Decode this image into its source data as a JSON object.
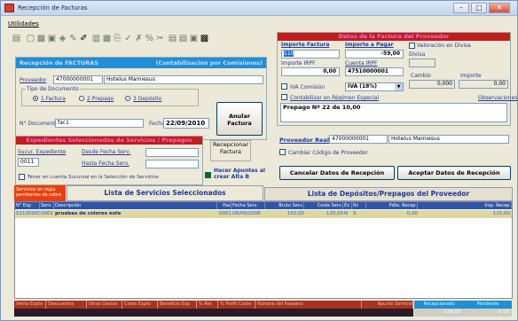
{
  "window": {
    "title": "Recepción de Facturas",
    "min": "–",
    "max": "□",
    "close": "✕"
  },
  "menu": {
    "utilidades": "Utilidades"
  },
  "left_header": {
    "title": "Recepción de FACTURAS",
    "mode": "(Contabilización por Comisiones)"
  },
  "proveedor": {
    "label": "Proveedor",
    "code": "47000000001",
    "name": "Hotelus Mamiesus"
  },
  "tipo_documento": {
    "legend": "Tipo de Documento",
    "options": [
      "1 Factura",
      "2 Prepago",
      "3 Depósito"
    ],
    "selected": "1 Factura"
  },
  "documento": {
    "label": "N° Documento",
    "value": "fac1",
    "fecha_label": "Fecha",
    "fecha": "22/09/2010"
  },
  "anular_button": "Anular Factura",
  "servicios_box": {
    "header": "Expedientes Seleccionados de Servicios / Prepagos",
    "sucursal_label": "Sucur. Expediente",
    "sucursal": "0011",
    "desde_label": "Desde Fecha Serv.",
    "hasta_label": "Hasta Fecha Serv.",
    "tener_cuenta": "Tener en cuenta Sucursal en la Selección de Servicios",
    "tener_checked": true
  },
  "recepcionar_button": "Recepcionar Factura",
  "hacer_apuntes": {
    "label": "Hacer Apuntes al crear Alta B",
    "checked": true
  },
  "datos": {
    "header": "Datos de la Factura del Proveedor",
    "importe_factura_label": "Importe Factura",
    "importe_factura": "110",
    "importe_pagar_label": "Importe a Pagar",
    "importe_pagar": "-59,00",
    "importe_irpf_label": "Importe IRPF",
    "importe_irpf": "0,00",
    "cuenta_irpf_label": "Cuenta IRPF",
    "cuenta_irpf": "47510000001",
    "valoracion_label": "Valoración en Divisa",
    "divisa_label": "Divisa",
    "cambio_label": "Cambio",
    "cambio": "0,000",
    "importe_label": "Importe",
    "importe": "0,00",
    "iva_comision_label": "IVA Comisión",
    "iva_comision": "IVA (18%)",
    "contabilizar_label": "Contabilizar en Régimen Especial",
    "observaciones_label": "Observaciones",
    "observaciones": "Prepago Nº 22 de 10,00"
  },
  "proveedor_real": {
    "label": "Proveedor Real",
    "code": "47000000001",
    "name": "Hotelus Mamiesus"
  },
  "cambiar_codigo": "Cambiar Código de Proveedor",
  "cancelar_button": "Cancelar Datos de Recepción",
  "aceptar_button": "Aceptar Datos de Recepción",
  "tabs": {
    "badge": "Servicios en regla pendientes de cobro",
    "servicios": "Lista de Servicios Seleccionados",
    "depositos": "Lista de Depósitos/Prepagos del Proveedor"
  },
  "table": {
    "headers": [
      "N° Exp",
      "Serv.",
      "Descripción",
      "Pax",
      "Fecha Serv.",
      "Bruto Serv.",
      "Coste Serv.",
      "Ex",
      "Rc",
      "Pdte. Recep.",
      "Imp. Recep."
    ],
    "rows": [
      [
        "011000000",
        "0001",
        "pruebas de colores este",
        "0001",
        "08/09/2008",
        "150,00",
        "120,00",
        "N",
        "S",
        "0,00",
        "110,00"
      ]
    ]
  },
  "footer": {
    "cols": [
      "Venta Expte",
      "Descuentos",
      "Otros Gastos",
      "Coste Expte",
      "Beneficio Exp",
      "% Ret",
      "% Profit Coste",
      "Nombre del Pasajero",
      "Apunte Servicio"
    ],
    "recepcionado_label": "Recepcionado",
    "recepcionado": "110,00",
    "pendiente_label": "Pendiente",
    "pendiente": "0,00"
  },
  "colors": {
    "accent": "#1f8fd8",
    "header_red": "#c11d1d",
    "row_highlight": "#ddd7a0",
    "footer_dark": "#2a1a2a"
  }
}
